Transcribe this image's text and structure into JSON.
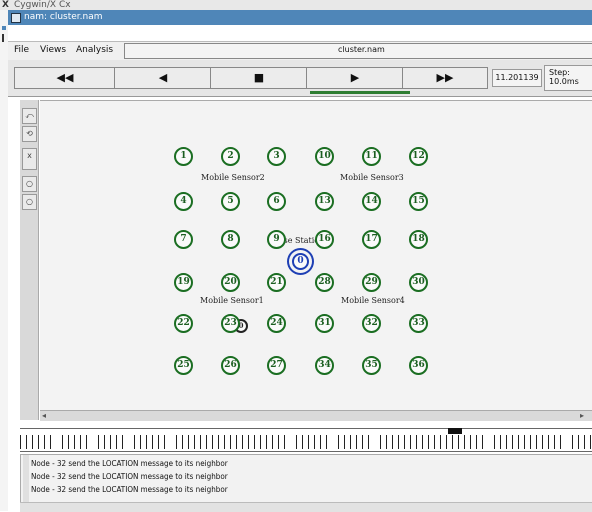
{
  "outer": {
    "title": "Cygwin/X  Cx"
  },
  "window": {
    "title": "nam: cluster.nam"
  },
  "menu": {
    "items": [
      "File",
      "Views",
      "Analysis"
    ],
    "filename": "cluster.nam"
  },
  "toolbar": {
    "rewind": "◀◀",
    "back": "◀",
    "stop": "■",
    "play": "▶",
    "forward": "▶▶",
    "time": "11.201139",
    "step": "Step: 10.0ms"
  },
  "sidetools": [
    "⤺",
    "⟲",
    "ⅹ",
    "○",
    "○"
  ],
  "nodes": [
    {
      "id": "1",
      "col": 0,
      "row": 0
    },
    {
      "id": "2",
      "col": 1,
      "row": 0
    },
    {
      "id": "3",
      "col": 2,
      "row": 0
    },
    {
      "id": "10",
      "col": 3,
      "row": 0
    },
    {
      "id": "11",
      "col": 4,
      "row": 0
    },
    {
      "id": "12",
      "col": 5,
      "row": 0
    },
    {
      "id": "4",
      "col": 0,
      "row": 1
    },
    {
      "id": "5",
      "col": 1,
      "row": 1
    },
    {
      "id": "6",
      "col": 2,
      "row": 1
    },
    {
      "id": "13",
      "col": 3,
      "row": 1
    },
    {
      "id": "14",
      "col": 4,
      "row": 1
    },
    {
      "id": "15",
      "col": 5,
      "row": 1
    },
    {
      "id": "7",
      "col": 0,
      "row": 2
    },
    {
      "id": "8",
      "col": 1,
      "row": 2
    },
    {
      "id": "9",
      "col": 2,
      "row": 2
    },
    {
      "id": "16",
      "col": 3,
      "row": 2
    },
    {
      "id": "17",
      "col": 4,
      "row": 2
    },
    {
      "id": "18",
      "col": 5,
      "row": 2
    },
    {
      "id": "19",
      "col": 0,
      "row": 3
    },
    {
      "id": "20",
      "col": 1,
      "row": 3
    },
    {
      "id": "21",
      "col": 2,
      "row": 3
    },
    {
      "id": "28",
      "col": 3,
      "row": 3
    },
    {
      "id": "29",
      "col": 4,
      "row": 3
    },
    {
      "id": "30",
      "col": 5,
      "row": 3
    },
    {
      "id": "22",
      "col": 0,
      "row": 4
    },
    {
      "id": "23",
      "col": 1,
      "row": 4
    },
    {
      "id": "24",
      "col": 2,
      "row": 4
    },
    {
      "id": "31",
      "col": 3,
      "row": 4
    },
    {
      "id": "32",
      "col": 4,
      "row": 4
    },
    {
      "id": "33",
      "col": 5,
      "row": 4
    },
    {
      "id": "25",
      "col": 0,
      "row": 5
    },
    {
      "id": "26",
      "col": 1,
      "row": 5
    },
    {
      "id": "27",
      "col": 2,
      "row": 5
    },
    {
      "id": "34",
      "col": 3,
      "row": 5
    },
    {
      "id": "35",
      "col": 4,
      "row": 5
    },
    {
      "id": "36",
      "col": 5,
      "row": 5
    }
  ],
  "base_station": {
    "id": "0",
    "label": "Base Station"
  },
  "mobile_node": {
    "id": "0"
  },
  "sensor_labels": [
    "Mobile Sensor2",
    "Mobile Sensor3",
    "Mobile Sensor1",
    "Mobile Sensor4"
  ],
  "log": [
    "Node - 32 send the LOCATION message to its neighbor",
    "Node - 32 send the LOCATION message to its neighbor",
    "Node - 32 send the LOCATION message to its neighbor"
  ],
  "colors": {
    "node_ring": "#1b6e22",
    "base_ring": "#1e3fb4",
    "titlebar": "#4f86b8"
  }
}
